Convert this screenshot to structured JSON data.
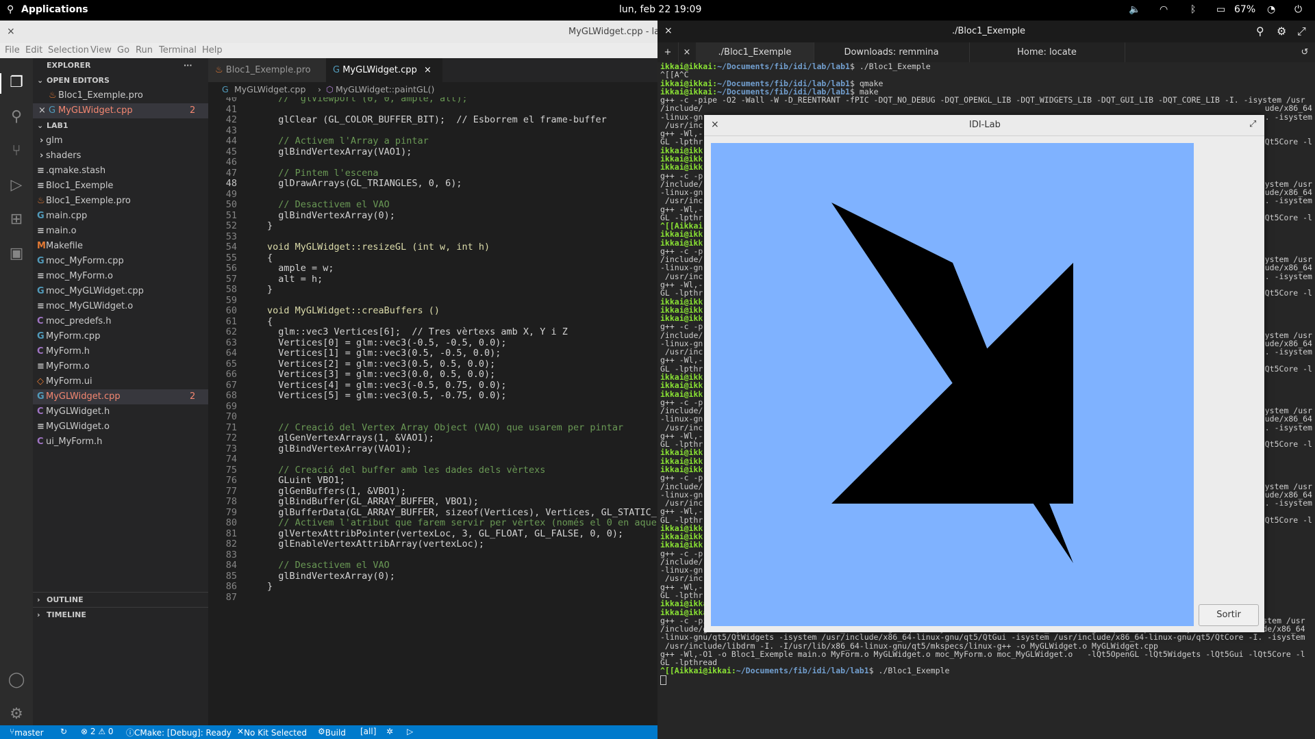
{
  "topbar": {
    "apps_label": "Applications",
    "date": "lun, feb 22",
    "time": "19:09",
    "battery": "67%"
  },
  "vscode": {
    "title": "MyGLWidget.cpp - lab",
    "menu": [
      "File",
      "Edit",
      "Selection",
      "View",
      "Go",
      "Run",
      "Terminal",
      "Help"
    ],
    "explorer_title": "EXPLORER",
    "open_editors_label": "OPEN EDITORS",
    "open_editors": [
      {
        "name": "Bloc1_Exemple.pro"
      },
      {
        "name": "MyGLWidget.cpp",
        "badge": "2"
      }
    ],
    "folder_label": "LAB1",
    "files": [
      "glm",
      "shaders",
      ".qmake.stash",
      "Bloc1_Exemple",
      "Bloc1_Exemple.pro",
      "main.cpp",
      "main.o",
      "Makefile",
      "moc_MyForm.cpp",
      "moc_MyForm.o",
      "moc_MyGLWidget.cpp",
      "moc_MyGLWidget.o",
      "moc_predefs.h",
      "MyForm.cpp",
      "MyForm.h",
      "MyForm.o",
      "MyForm.ui",
      "MyGLWidget.cpp",
      "MyGLWidget.h",
      "MyGLWidget.o",
      "ui_MyForm.h"
    ],
    "selected_file_badge": "2",
    "outline_label": "OUTLINE",
    "timeline_label": "TIMELINE",
    "tabs": [
      "Bloc1_Exemple.pro",
      "MyGLWidget.cpp"
    ],
    "breadcrumb": [
      "MyGLWidget.cpp",
      "MyGLWidget::paintGL()"
    ],
    "code_lines": [
      {
        "n": "40",
        "t": "  //  glViewport (0, 0, ample, alt);"
      },
      {
        "n": "41",
        "t": ""
      },
      {
        "n": "42",
        "t": "  glClear (GL_COLOR_BUFFER_BIT);  // Esborrem el frame-buffer"
      },
      {
        "n": "43",
        "t": ""
      },
      {
        "n": "44",
        "t": "  // Activem l'Array a pintar"
      },
      {
        "n": "45",
        "t": "  glBindVertexArray(VAO1);"
      },
      {
        "n": "46",
        "t": ""
      },
      {
        "n": "47",
        "t": "  // Pintem l'escena"
      },
      {
        "n": "48",
        "t": "  glDrawArrays(GL_TRIANGLES, 0, 6);"
      },
      {
        "n": "49",
        "t": ""
      },
      {
        "n": "50",
        "t": "  // Desactivem el VAO"
      },
      {
        "n": "51",
        "t": "  glBindVertexArray(0);"
      },
      {
        "n": "52",
        "t": "}"
      },
      {
        "n": "53",
        "t": ""
      },
      {
        "n": "54",
        "t": "void MyGLWidget::resizeGL (int w, int h)"
      },
      {
        "n": "55",
        "t": "{"
      },
      {
        "n": "56",
        "t": "  ample = w;"
      },
      {
        "n": "57",
        "t": "  alt = h;"
      },
      {
        "n": "58",
        "t": "}"
      },
      {
        "n": "59",
        "t": ""
      },
      {
        "n": "60",
        "t": "void MyGLWidget::creaBuffers ()"
      },
      {
        "n": "61",
        "t": "{"
      },
      {
        "n": "62",
        "t": "  glm::vec3 Vertices[6];  // Tres vèrtexs amb X, Y i Z"
      },
      {
        "n": "63",
        "t": "  Vertices[0] = glm::vec3(-0.5, -0.5, 0.0);"
      },
      {
        "n": "64",
        "t": "  Vertices[1] = glm::vec3(0.5, -0.5, 0.0);"
      },
      {
        "n": "65",
        "t": "  Vertices[2] = glm::vec3(0.5, 0.5, 0.0);"
      },
      {
        "n": "66",
        "t": "  Vertices[3] = glm::vec3(0.0, 0.5, 0.0);"
      },
      {
        "n": "67",
        "t": "  Vertices[4] = glm::vec3(-0.5, 0.75, 0.0);"
      },
      {
        "n": "68",
        "t": "  Vertices[5] = glm::vec3(0.5, -0.75, 0.0);"
      },
      {
        "n": "69",
        "t": ""
      },
      {
        "n": "70",
        "t": ""
      },
      {
        "n": "71",
        "t": "  // Creació del Vertex Array Object (VAO) que usarem per pintar"
      },
      {
        "n": "72",
        "t": "  glGenVertexArrays(1, &VAO1);"
      },
      {
        "n": "73",
        "t": "  glBindVertexArray(VAO1);"
      },
      {
        "n": "74",
        "t": ""
      },
      {
        "n": "75",
        "t": "  // Creació del buffer amb les dades dels vèrtexs"
      },
      {
        "n": "76",
        "t": "  GLuint VBO1;"
      },
      {
        "n": "77",
        "t": "  glGenBuffers(1, &VBO1);"
      },
      {
        "n": "78",
        "t": "  glBindBuffer(GL_ARRAY_BUFFER, VBO1);"
      },
      {
        "n": "79",
        "t": "  glBufferData(GL_ARRAY_BUFFER, sizeof(Vertices), Vertices, GL_STATIC_"
      },
      {
        "n": "80",
        "t": "  // Activem l'atribut que farem servir per vèrtex (només el 0 en aque"
      },
      {
        "n": "81",
        "t": "  glVertexAttribPointer(vertexLoc, 3, GL_FLOAT, GL_FALSE, 0, 0);"
      },
      {
        "n": "82",
        "t": "  glEnableVertexAttribArray(vertexLoc);"
      },
      {
        "n": "83",
        "t": ""
      },
      {
        "n": "84",
        "t": "  // Desactivem el VAO"
      },
      {
        "n": "85",
        "t": "  glBindVertexArray(0);"
      },
      {
        "n": "86",
        "t": "}"
      },
      {
        "n": "87",
        "t": ""
      }
    ],
    "status": {
      "branch": "master",
      "problems": "⊗ 2 ⚠ 0",
      "cmake": "CMake: [Debug]: Ready",
      "kit": "No Kit Selected",
      "build": "Build",
      "all": "[all]"
    }
  },
  "terminal": {
    "title": "./Bloc1_Exemple",
    "tabs": [
      "./Bloc1_Exemple",
      "Downloads: remmina",
      "Home: locate"
    ],
    "lines": [
      {
        "p": "ikkai@ikkai",
        "d": "~/Documents/fib/idi/lab/lab1",
        "c": "$ ./Bloc1_Exemple"
      },
      {
        "t": "^[[A^C"
      },
      {
        "p": "ikkai@ikkai",
        "d": "~/Documents/fib/idi/lab/lab1",
        "c": "$ qmake"
      },
      {
        "p": "ikkai@ikkai",
        "d": "~/Documents/fib/idi/lab/lab1",
        "c": "$ make"
      },
      {
        "t": "g++ -c -pipe -O2 -Wall -W -D_REENTRANT -fPIC -DQT_NO_DEBUG -DQT_OPENGL_LIB -DQT_WIDGETS_LIB -DQT_GUI_LIB -DQT_CORE_LIB -I. -isystem /usr"
      },
      {
        "t": "/include/"
      },
      {
        "t": "-linux-gn"
      },
      {
        "t": " /usr/inc"
      },
      {
        "t": "g++ -Wl,-"
      },
      {
        "t": "GL -lpthr"
      },
      {
        "t": "ikkai@ikk"
      },
      {
        "t": "ikkai@ikk"
      },
      {
        "t": "ikkai@ikk"
      },
      {
        "t": "g++ -c -p"
      },
      {
        "t": "/include/"
      },
      {
        "t": "-linux-gn"
      },
      {
        "t": " /usr/inc"
      },
      {
        "t": "g++ -Wl,-"
      },
      {
        "t": "GL -lpthr"
      },
      {
        "t": "^[[Aikkai"
      },
      {
        "t": "ikkai@ikk"
      },
      {
        "t": "ikkai@ikk"
      },
      {
        "t": "g++ -c -p"
      },
      {
        "t": "/include/"
      },
      {
        "t": "-linux-gn"
      },
      {
        "t": " /usr/inc"
      },
      {
        "t": "g++ -Wl,-"
      },
      {
        "t": "GL -lpthr"
      },
      {
        "t": "ikkai@ikk"
      },
      {
        "t": "ikkai@ikk"
      },
      {
        "t": "ikkai@ikk"
      },
      {
        "t": "g++ -c -p"
      },
      {
        "t": "/include/"
      },
      {
        "t": "-linux-gn"
      },
      {
        "t": " /usr/inc"
      },
      {
        "t": "g++ -Wl,-"
      },
      {
        "t": "GL -lpthr"
      },
      {
        "t": "ikkai@ikk"
      },
      {
        "t": "ikkai@ikk"
      },
      {
        "t": "ikkai@ikk"
      },
      {
        "t": "g++ -c -p"
      },
      {
        "t": "/include/"
      },
      {
        "t": "-linux-gn"
      },
      {
        "t": " /usr/inc"
      },
      {
        "t": "g++ -Wl,-"
      },
      {
        "t": "GL -lpthr"
      },
      {
        "t": "ikkai@ikk"
      },
      {
        "t": "ikkai@ikk"
      },
      {
        "t": "ikkai@ikk"
      },
      {
        "t": "g++ -c -p"
      },
      {
        "t": "/include/"
      },
      {
        "t": "-linux-gn"
      },
      {
        "t": " /usr/inc"
      },
      {
        "t": "g++ -Wl,-"
      },
      {
        "t": "GL -lpthr"
      },
      {
        "t": "ikkai@ikk"
      },
      {
        "t": "ikkai@ikk"
      },
      {
        "t": "ikkai@ikk"
      },
      {
        "t": "g++ -c -p"
      },
      {
        "t": "/include/"
      },
      {
        "t": "-linux-gn"
      },
      {
        "t": " /usr/inc"
      },
      {
        "t": "g++ -Wl,-"
      },
      {
        "t": "GL -lpthr"
      },
      {
        "p": "ikkai@ikkai",
        "d": "~/Documents/fib/idi/lab/lab1",
        "c": "$ ./Bloc1_Exemple"
      },
      {
        "p": "ikkai@ikkai",
        "d": "~/Documents/fib/idi/lab/lab1",
        "c": "$ make"
      },
      {
        "t": "g++ -c -pipe -O2 -Wall -W -D_REENTRANT -fPIC -DQT_NO_DEBUG -DQT_OPENGL_LIB -DQT_WIDGETS_LIB -DQT_GUI_LIB -DQT_CORE_LIB -I. -isystem /usr"
      },
      {
        "t": "/include/glm -isystem /usr/include/x86_64-linux-gnu/qt5 -isystem /usr/include/x86_64-linux-gnu/qt5/QtOpenGL -isystem /usr/include/x86_64"
      },
      {
        "t": "-linux-gnu/qt5/QtWidgets -isystem /usr/include/x86_64-linux-gnu/qt5/QtGui -isystem /usr/include/x86_64-linux-gnu/qt5/QtCore -I. -isystem"
      },
      {
        "t": " /usr/include/libdrm -I. -I/usr/lib/x86_64-linux-gnu/qt5/mkspecs/linux-g++ -o MyGLWidget.o MyGLWidget.cpp"
      },
      {
        "t": "g++ -Wl,-O1 -o Bloc1_Exemple main.o MyForm.o MyGLWidget.o moc_MyForm.o moc_MyGLWidget.o   -lQt5OpenGL -lQt5Widgets -lQt5Gui -lQt5Core -l"
      },
      {
        "t": "GL -lpthread"
      },
      {
        "p": "^[[Aikkai@ikkai",
        "d": "~/Documents/fib/idi/lab/lab1",
        "c": "$ ./Bloc1_Exemple"
      }
    ],
    "right_fragments": [
      {
        "row": 5,
        "t": "ude/x86_64"
      },
      {
        "row": 6,
        "t": ". -isystem"
      },
      {
        "row": 9,
        "t": "Qt5Core -l"
      },
      {
        "row": 14,
        "t": "ystem /usr"
      },
      {
        "row": 15,
        "t": "ude/x86_64"
      },
      {
        "row": 16,
        "t": ". -isystem"
      },
      {
        "row": 18,
        "t": "Qt5Core -l"
      },
      {
        "row": 23,
        "t": "ystem /usr"
      },
      {
        "row": 24,
        "t": "ude/x86_64"
      },
      {
        "row": 25,
        "t": ". -isystem"
      },
      {
        "row": 27,
        "t": "Qt5Core -l"
      },
      {
        "row": 32,
        "t": "ystem /usr"
      },
      {
        "row": 33,
        "t": "ude/x86_64"
      },
      {
        "row": 34,
        "t": ". -isystem"
      },
      {
        "row": 36,
        "t": "Qt5Core -l"
      },
      {
        "row": 41,
        "t": "ystem /usr"
      },
      {
        "row": 42,
        "t": "ude/x86_64"
      },
      {
        "row": 43,
        "t": ". -isystem"
      },
      {
        "row": 45,
        "t": "Qt5Core -l"
      },
      {
        "row": 50,
        "t": "ystem /usr"
      },
      {
        "row": 51,
        "t": "ude/x86_64"
      },
      {
        "row": 52,
        "t": ". -isystem"
      },
      {
        "row": 54,
        "t": "Qt5Core -l"
      }
    ]
  },
  "idilab": {
    "title": "IDI-Lab",
    "button": "Sortir",
    "clear_color": "#7fb2ff",
    "shape_color": "#000000"
  }
}
